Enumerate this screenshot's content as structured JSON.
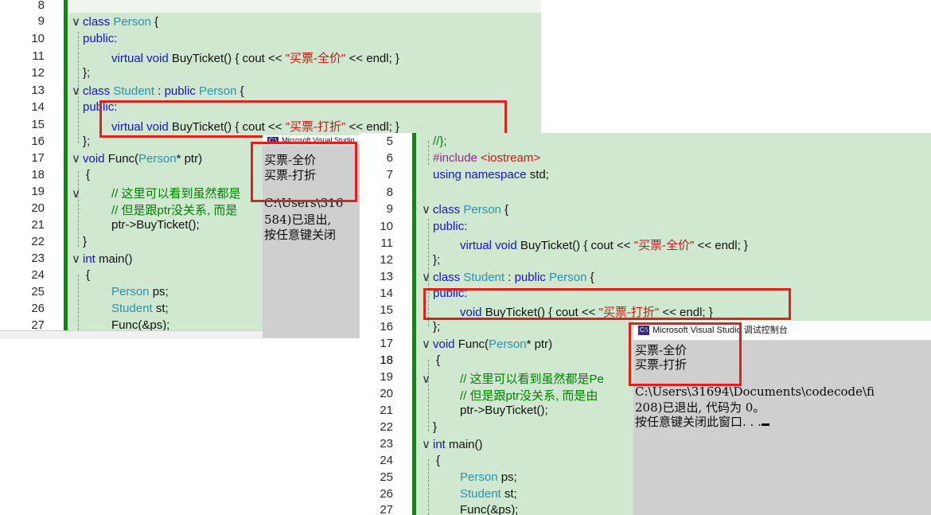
{
  "left_editor": {
    "line_numbers": [
      "8",
      "9",
      "10",
      "11",
      "12",
      "13",
      "14",
      "15",
      "16",
      "17",
      "18",
      "19",
      "20",
      "21",
      "22",
      "23",
      "24",
      "25",
      "26",
      "27"
    ],
    "lines": {
      "l9": [
        "class",
        " Person",
        " {"
      ],
      "l10": "public:",
      "l11": [
        "virtual",
        " void",
        " BuyTicket() { cout << ",
        "\"买票-全价\"",
        " << endl; }"
      ],
      "l12": "};",
      "l13": [
        "class",
        " Student",
        " : ",
        "public",
        " Person",
        " {"
      ],
      "l14": "public:",
      "l15": [
        "virtual",
        " void",
        " BuyTicket() { cout << ",
        "\"买票-打折\"",
        " << endl; }"
      ],
      "l16": "};",
      "l17": [
        "void",
        " Func(",
        "Person",
        "* ptr)"
      ],
      "l18": "{",
      "l19": "// 这里可以看到虽然都是",
      "l20": "// 但是跟ptr没关系, 而是",
      "l21": "ptr->BuyTicket();",
      "l22": "}",
      "l23": [
        "int",
        " main()"
      ],
      "l24": "{",
      "l25": [
        "Person",
        " ps;"
      ],
      "l26": [
        "Student",
        " st;"
      ],
      "l27": "Func(&ps);"
    }
  },
  "left_console": {
    "title": "Microsoft Visual Studio",
    "lines": [
      "买票-全价",
      "买票-打折",
      "C:\\Users\\316",
      "584)已退出,",
      "按任意键关闭"
    ]
  },
  "right_editor": {
    "line_numbers": [
      "5",
      "6",
      "7",
      "8",
      "9",
      "10",
      "11",
      "12",
      "13",
      "14",
      "15",
      "16",
      "17",
      "18",
      "19",
      "20",
      "21",
      "22",
      "23",
      "24",
      "25",
      "26",
      "27"
    ],
    "lines": {
      "l5": "//};",
      "l6": [
        "#include",
        " <iostream>"
      ],
      "l7": [
        "using",
        " namespace",
        " std;"
      ],
      "l9": [
        "class",
        " Person",
        " {"
      ],
      "l10": "public:",
      "l11": [
        "virtual",
        " void",
        " BuyTicket() { cout << ",
        "\"买票-全价\"",
        " << endl; }"
      ],
      "l12": "};",
      "l13": [
        "class",
        " Student",
        " : ",
        "public",
        " Person",
        " {"
      ],
      "l14": "public:",
      "l15": [
        "void",
        " BuyTicket() { cout << ",
        "\"买票-打折\"",
        " << endl; }"
      ],
      "l16": "};",
      "l17": [
        "void",
        " Func(",
        "Person",
        "* ptr)"
      ],
      "l18": "{",
      "l19": "// 这里可以看到虽然都是Pe",
      "l20": "// 但是跟ptr没关系, 而是由",
      "l21": "ptr->BuyTicket();",
      "l22": "}",
      "l23": [
        "int",
        " main()"
      ],
      "l24": "{",
      "l25": [
        "Person",
        " ps;"
      ],
      "l26": [
        "Student",
        " st;"
      ],
      "l27": "Func(&ps);"
    }
  },
  "right_console": {
    "title_app": "Microsoft Visual Studio",
    "title_suffix": "调试控制台",
    "lines": [
      "买票-全价",
      "买票-打折",
      "C:\\Users\\31694\\Documents\\codecode\\fi",
      "208)已退出, 代码为 0。",
      "按任意键关闭此窗口. . ."
    ]
  },
  "colors": {
    "editor_bg": "#cfe8cf",
    "highlight_box": "#e0201c",
    "console_bg": "#cfcfcf",
    "keyword": "#1414d0",
    "type": "#2b91af",
    "string": "#c41a16",
    "comment": "#008000"
  }
}
